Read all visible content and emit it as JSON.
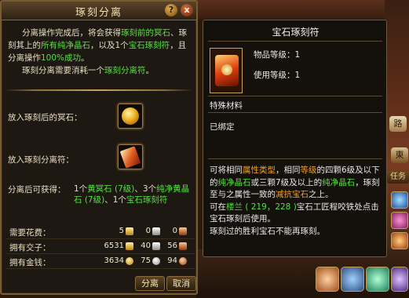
{
  "separation_window": {
    "title": "琢刻分离",
    "help_label": "?",
    "close_label": "x",
    "intro": {
      "p1_a": "分离操作完成后，将会获得",
      "p1_b": "琢刻前的冥石",
      "p1_c": "、琢刻其上的",
      "p1_d": "所有纯净晶石",
      "p1_e": "，以及1个",
      "p1_f": "宝石琢刻符",
      "p1_g": "，且分离操作",
      "p1_h": "100%成功",
      "p1_i": "。",
      "p2_a": "琢刻分离需要消耗一个",
      "p2_b": "琢刻分离符",
      "p2_c": "。"
    },
    "slot1_label": "放入琢刻后的冥石：",
    "slot2_label": "放入琢刻分离符：",
    "obtain_label": "分离后可获得：",
    "obtain": {
      "a": "1个",
      "b": "黄冥石 (7级)",
      "c": "、3个",
      "d": "纯净黄晶石 (7级)",
      "e": "、1个",
      "f": "宝石琢刻符"
    },
    "costs": [
      {
        "label": "需要花费：",
        "v1": "5",
        "v2": "0",
        "v3": "0"
      },
      {
        "label": "拥有交子：",
        "v1": "6531",
        "v2": "40",
        "v3": "56"
      },
      {
        "label": "拥有金钱：",
        "v1": "3634",
        "v2": "75",
        "v3": "94"
      }
    ],
    "buttons": {
      "separate": "分离",
      "cancel": "取消"
    }
  },
  "tooltip": {
    "title": "宝石琢刻符",
    "item_level": "物品等级：1",
    "use_level": "使用等级：1",
    "category": "特殊材料",
    "bound": "已绑定",
    "desc": {
      "a": "可将相同",
      "b": "属性类型",
      "c": "，相同",
      "d": "等级",
      "e": "的四颗6级及以下的",
      "f": "纯净晶石",
      "g": "或三颗7级及以上的",
      "h": "纯净晶石",
      "i": "，琢刻至与之属性一致的",
      "j": "减抗宝石",
      "k": "之上。",
      "l": "可在",
      "m": "楼兰 ( 219，228 )",
      "n": "宝石工匠程咬铁处点击宝石琢刻后使用。",
      "o": "琢刻过的胜利宝石不能再琢刻。"
    }
  },
  "hud": {
    "road_label": "路",
    "east_label": "東",
    "task_label": "任务"
  }
}
